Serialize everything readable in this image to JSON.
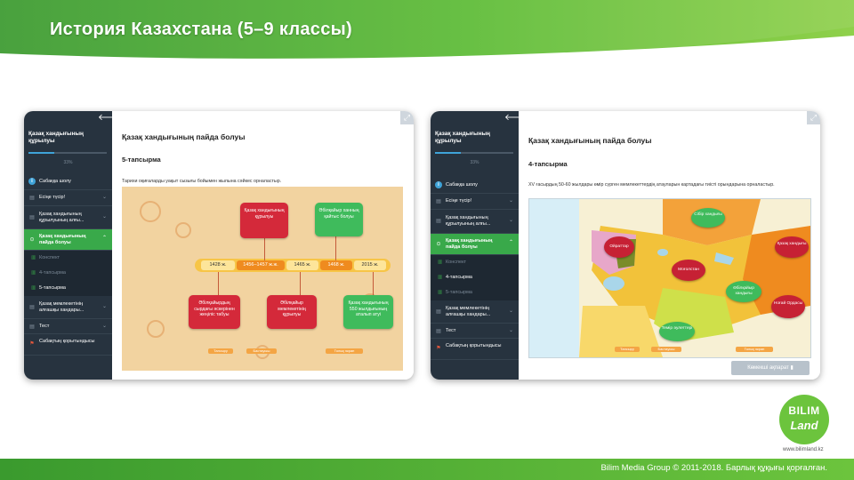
{
  "page": {
    "title": "История  Казахстана  (5–9 классы)",
    "footer": "Bilim Media  Group  © 2011-2018. Барлық құқығы қорғалған.",
    "logo_line1": "BILIM",
    "logo_line2": "Land",
    "logo_url": "www.bilimland.kz"
  },
  "panel1": {
    "sidebar": {
      "title": "Қазақ хандығының құрылуы",
      "progress": 0.33,
      "progress_label": "33%",
      "items": [
        {
          "label": "Сабаққа шолу",
          "icon": "info-icon"
        },
        {
          "label": "Есіңе түсір!",
          "icon": "book-icon"
        },
        {
          "label": "Қазақ хандығының құрылуының алғы...",
          "icon": "book-icon"
        },
        {
          "label": "Қазақ хандығының пайда болуы",
          "icon": "check-icon",
          "active": true
        },
        {
          "label": "Конспект",
          "icon": "book-icon"
        },
        {
          "label": "4-тапсырма",
          "icon": "book-icon"
        },
        {
          "label": "5-тапсырма",
          "icon": "book-icon"
        },
        {
          "label": "Қазақ мемлекетінің алғашқы хандары...",
          "icon": "book-icon"
        },
        {
          "label": "Тест",
          "icon": "book-icon"
        },
        {
          "label": "Сабақтың қорытындысы",
          "icon": "flag-icon"
        }
      ]
    },
    "content": {
      "title": "Қазақ хандығының пайда болуы",
      "task": "5-тапсырма",
      "instruction": "Тарихи оқиғаларды уақыт сызығы бойымен жылына сәйкес орналастыр.",
      "timeline": [
        "1428 ж.",
        "1456–1457 ж.ж.",
        "1465 ж.",
        "1468 ж.",
        "2015 ж."
      ],
      "cards_top": [
        "Қазақ хандығының құрылуы",
        "Әбілқайыр ханның қайтыс болуы"
      ],
      "cards_bottom": [
        "Әбілқайырдың сырдағы әскерінен жеңіліс табуы",
        "Әбілқайыр мемлекетінің құрылуы",
        "Қазақ хандығының 550 жылдығының аталып атуі"
      ],
      "buttons": [
        "Тапсыру",
        "Бастауыш",
        "Толық экран"
      ]
    }
  },
  "panel2": {
    "sidebar": {
      "title": "Қазақ хандығының құрылуы",
      "progress": 0.33,
      "progress_label": "33%",
      "items": [
        {
          "label": "Сабаққа шолу",
          "icon": "info-icon"
        },
        {
          "label": "Есіңе түсір!",
          "icon": "book-icon"
        },
        {
          "label": "Қазақ хандығының құрылуының алғы...",
          "icon": "book-icon"
        },
        {
          "label": "Қазақ хандығының пайда болуы",
          "icon": "check-icon",
          "active": true
        },
        {
          "label": "Конспект",
          "icon": "book-icon"
        },
        {
          "label": "4-тапсырма",
          "icon": "book-icon"
        },
        {
          "label": "5-тапсырма",
          "icon": "book-icon"
        },
        {
          "label": "Қазақ мемлекетінің алғашқы хандары...",
          "icon": "book-icon"
        },
        {
          "label": "Тест",
          "icon": "book-icon"
        },
        {
          "label": "Сабақтың қорытындысы",
          "icon": "flag-icon"
        }
      ]
    },
    "content": {
      "title": "Қазақ хандығының пайда болуы",
      "task": "4-тапсырма",
      "instruction": "XV ғасырдың 50-60 жылдары өмір сүрген мемлекеттердің атауларын картадағы тиісті орындарына орналастыр.",
      "map_labels": [
        "Ойраттар",
        "Сібір хандығы",
        "Қазақ хандығы",
        "Моғолстан",
        "Әбілқайыр хандығы",
        "Ноғай Ордасы",
        "Темір әулеттері"
      ],
      "buttons": [
        "Тапсыру",
        "Бастауыш",
        "Толық экран"
      ],
      "help_button": "Көмекші ақпарат"
    }
  }
}
